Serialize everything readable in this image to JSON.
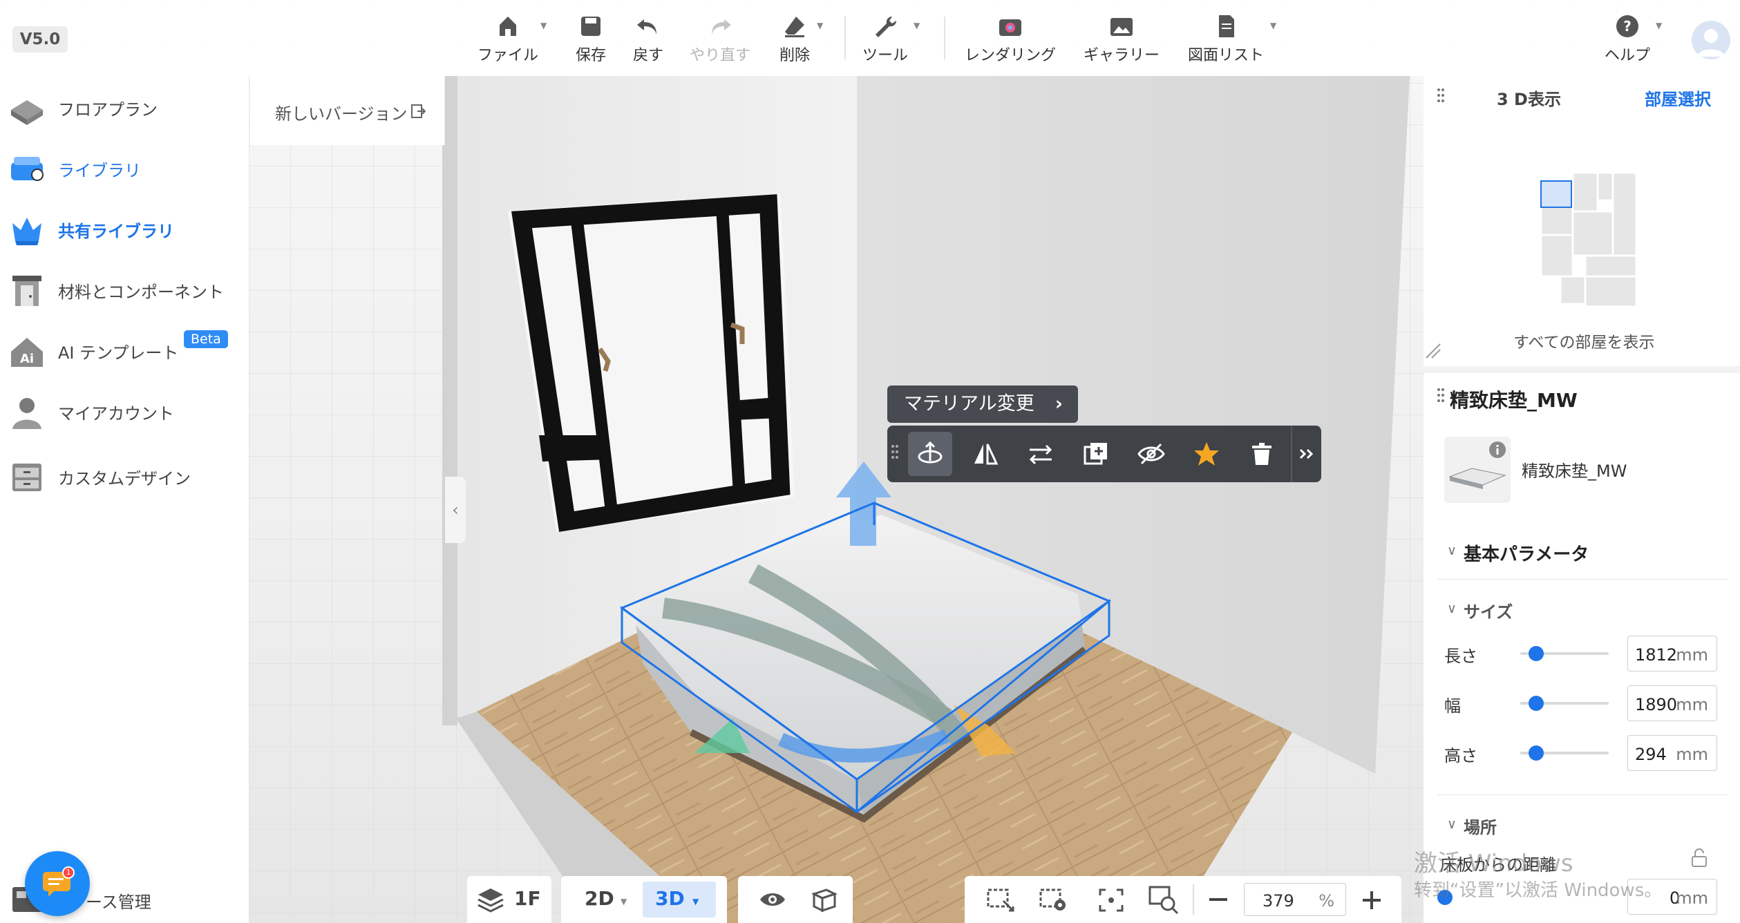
{
  "app": {
    "version": "V5.0"
  },
  "toolbar": {
    "items": [
      {
        "label": "ファイル",
        "icon": "home-icon"
      },
      {
        "label": "保存",
        "icon": "save-icon"
      },
      {
        "label": "戻す",
        "icon": "undo-icon"
      },
      {
        "label": "やり直す",
        "icon": "redo-icon"
      },
      {
        "label": "削除",
        "icon": "eraser-icon"
      },
      {
        "label": "ツール",
        "icon": "wrench-icon"
      },
      {
        "label": "レンダリング",
        "icon": "camera-icon"
      },
      {
        "label": "ギャラリー",
        "icon": "gallery-icon"
      },
      {
        "label": "図面リスト",
        "icon": "document-icon"
      },
      {
        "label": "ヘルプ",
        "icon": "help-icon"
      }
    ]
  },
  "sidebar": {
    "items": [
      {
        "label": "フロアプラン",
        "icon": "floorplan-icon"
      },
      {
        "label": "ライブラリ",
        "icon": "library-icon"
      },
      {
        "label": "共有ライブラリ",
        "icon": "crown-icon"
      },
      {
        "label": "材料とコンポーネント",
        "icon": "door-icon"
      },
      {
        "label": "AI テンプレート",
        "icon": "ai-template-icon",
        "badge": "Beta"
      },
      {
        "label": "マイアカウント",
        "icon": "account-icon"
      },
      {
        "label": "カスタムデザイン",
        "icon": "cabinet-icon"
      }
    ],
    "new_version": "新しいバージョン",
    "bottom_label": "ース管理",
    "chat_badge": "1"
  },
  "object_toolbar": {
    "material_label": "マテリアル変更",
    "tools": [
      "rotate-icon",
      "mirror-icon",
      "swap-icon",
      "duplicate-icon",
      "hide-icon",
      "favorite-star-icon",
      "trash-icon",
      "expand-icon"
    ]
  },
  "right_panel": {
    "view_title": "3 D表示",
    "room_select": "部屋選択",
    "show_all_rooms": "すべての部屋を表示",
    "object_name": "精致床垫_MW",
    "object_thumb_name": "精致床垫_MW",
    "basic_params": "基本パラメータ",
    "size_section": "サイズ",
    "length_label": "長さ",
    "length_value": "1812",
    "width_label": "幅",
    "width_value": "1890",
    "height_label": "高さ",
    "height_value": "294",
    "unit": "mm",
    "location_section": "場所",
    "floor_distance_label": "床板からの距離",
    "floor_distance_value": "0"
  },
  "bottom_bar": {
    "floor": "1F",
    "view_2d": "2D",
    "view_3d": "3D",
    "zoom_value": "379",
    "zoom_unit": "%"
  },
  "watermark": {
    "line1": "激活 Windows",
    "line2": "转到“设置”以激活 Windows。"
  },
  "colors": {
    "accent": "#1e74e8",
    "toolbar_dark": "#3f4247",
    "star": "#f5a623"
  }
}
